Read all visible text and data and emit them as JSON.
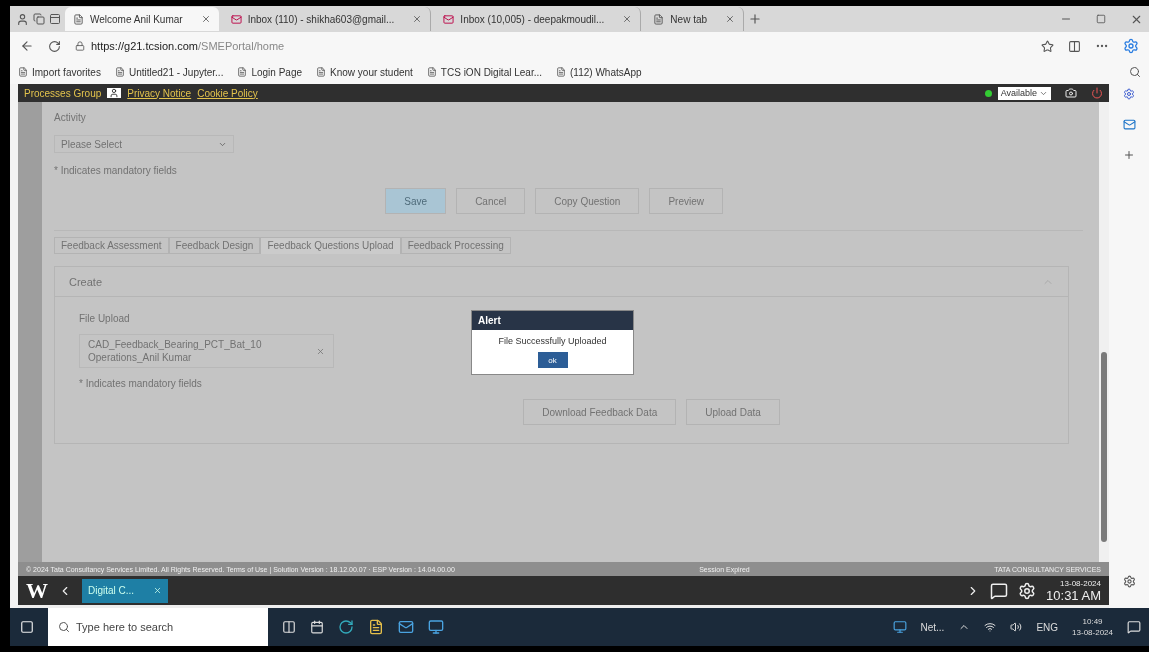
{
  "browser": {
    "tabs": [
      {
        "title": "Welcome Anil Kumar",
        "selected": true
      },
      {
        "title": "Inbox (110) - shikha603@gmail...",
        "selected": false
      },
      {
        "title": "Inbox (10,005) - deepakmoudil...",
        "selected": false
      },
      {
        "title": "New tab",
        "selected": false
      }
    ],
    "url_host": "https://g21.tcsion.com",
    "url_path": "/SMEPortal/home",
    "bookmarks": [
      "Import favorites",
      "Untitled21 - Jupyter...",
      "Login Page",
      "Know your student",
      "TCS iON Digital Lear...",
      "(112) WhatsApp"
    ]
  },
  "app_header": {
    "group": "Processes Group",
    "links": [
      "Privacy Notice",
      "Cookie Policy"
    ],
    "status": "Available"
  },
  "form": {
    "activity_label": "Activity",
    "activity_value": "Please Select",
    "note": "* Indicates mandatory fields",
    "buttons": [
      {
        "label": "Save",
        "primary": true
      },
      {
        "label": "Cancel",
        "primary": false
      },
      {
        "label": "Copy Question",
        "primary": false
      },
      {
        "label": "Preview",
        "primary": false
      }
    ]
  },
  "section_tabs": [
    {
      "label": "Feedback Assessment",
      "selected": false
    },
    {
      "label": "Feedback Design",
      "selected": false
    },
    {
      "label": "Feedback Questions Upload",
      "selected": true
    },
    {
      "label": "Feedback Processing",
      "selected": false
    }
  ],
  "panel": {
    "title": "Create",
    "file_label": "File Upload",
    "file_value": "CAD_Feedback_Bearing_PCT_Bat_10 Operations_Anil Kumar",
    "note": "* Indicates mandatory fields",
    "buttons": [
      {
        "label": "Download Feedback Data",
        "primary": false
      },
      {
        "label": "Upload Data",
        "primary": false
      }
    ]
  },
  "alert": {
    "title": "Alert",
    "message": "File Successfully Uploaded",
    "button": "ok"
  },
  "footer": {
    "copyright": "© 2024 Tata Consultancy Services Limited. All Rights Reserved.",
    "version": "Terms of Use | Solution Version : 18.12.00.07 · ESP Version : 14.04.00.00",
    "session": "Session Expired",
    "brand": "TATA CONSULTANCY SERVICES"
  },
  "remote_bar": {
    "logo": "W",
    "tab": "Digital C...",
    "date": "13-08-2024",
    "time": "10:31 AM"
  },
  "taskbar": {
    "search_placeholder": "Type here to search",
    "network": "Net...",
    "language": "ENG",
    "time": "10:49",
    "date": "13-08-2024"
  }
}
